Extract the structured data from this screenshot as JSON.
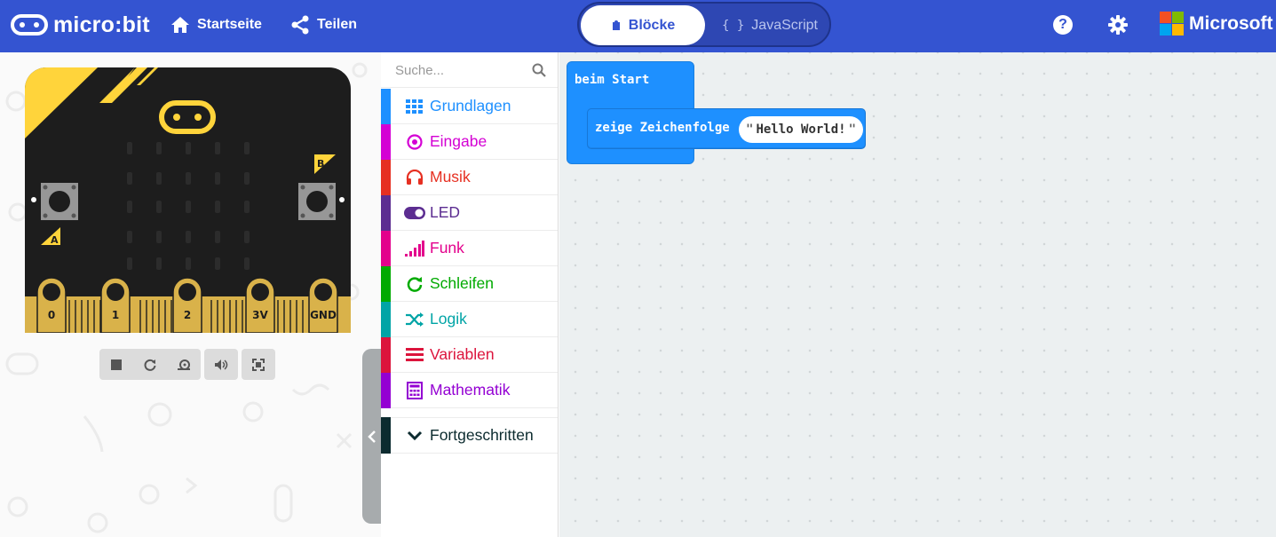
{
  "header": {
    "logo_text": "micro:bit",
    "home_label": "Startseite",
    "share_label": "Teilen",
    "tab_blocks": "Blöcke",
    "tab_js": "JavaScript",
    "tab_js_icon": "{ }",
    "help": "?",
    "brand": "Microsoft"
  },
  "board": {
    "button_a": "A",
    "button_b": "B",
    "pins": [
      "0",
      "1",
      "2",
      "3V",
      "GND"
    ]
  },
  "toolbox": {
    "search_placeholder": "Suche...",
    "categories": [
      {
        "label": "Grundlagen",
        "color": "#1e90ff",
        "icon": "grid-icon"
      },
      {
        "label": "Eingabe",
        "color": "#d400d4",
        "icon": "target-icon"
      },
      {
        "label": "Musik",
        "color": "#e63022",
        "icon": "headphones-icon"
      },
      {
        "label": "LED",
        "color": "#5c2d91",
        "icon": "toggle-icon"
      },
      {
        "label": "Funk",
        "color": "#e3008c",
        "icon": "signal-icon"
      },
      {
        "label": "Schleifen",
        "color": "#00aa00",
        "icon": "refresh-icon"
      },
      {
        "label": "Logik",
        "color": "#00a4a6",
        "icon": "shuffle-icon"
      },
      {
        "label": "Variablen",
        "color": "#dc143c",
        "icon": "list-icon"
      },
      {
        "label": "Mathematik",
        "color": "#9400d3",
        "icon": "calculator-icon"
      }
    ],
    "advanced": "Fortgeschritten"
  },
  "workspace": {
    "on_start": "beim Start",
    "show_string": "zeige Zeichenfolge",
    "string_value": "Hello World!",
    "quote": "\""
  }
}
